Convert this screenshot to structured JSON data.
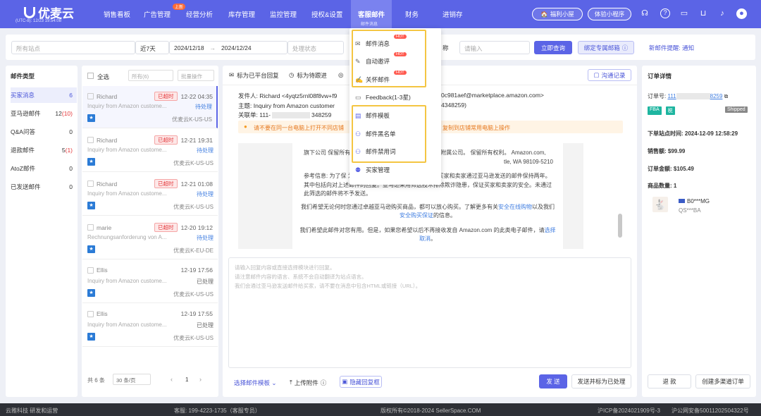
{
  "app": {
    "logo": "优麦云",
    "clock": "(UTC-8): 12/23 19:54:08"
  },
  "nav": {
    "items": [
      "销售看板",
      "广告管理",
      "经营分析",
      "库存管理",
      "监控管理",
      "授权&设置",
      "客服邮件",
      "财务",
      "进销存"
    ],
    "new_badge": "上新",
    "active": "客服邮件",
    "active_sub": "邮件消息"
  },
  "topbar": {
    "welfare": "福利小屋",
    "miniapp": "体验小程序",
    "icons": [
      "headset-icon",
      "help-icon",
      "document-icon",
      "cart-icon",
      "bell-icon",
      "user-icon"
    ]
  },
  "filter": {
    "site_placeholder": "所有站点",
    "range": "近7天",
    "date_start": "2024/12/18",
    "date_end": "2024/12/24",
    "status_placeholder": "处理状态",
    "field_tail": "称",
    "input_placeholder": "请输入",
    "query": "立即查询",
    "bind_mailbox": "绑定专属邮箱",
    "new_mail_reminder": "新邮件提醒: 通知"
  },
  "mail_types": {
    "title": "邮件类型",
    "items": [
      {
        "label": "买家消息",
        "count": "6",
        "red": ""
      },
      {
        "label": "亚马逊邮件",
        "count": "12",
        "red": "(10)"
      },
      {
        "label": "Q&A问答",
        "count": "0",
        "red": ""
      },
      {
        "label": "退款邮件",
        "count": "5",
        "red": "(1)"
      },
      {
        "label": "AtoZ邮件",
        "count": "0",
        "red": ""
      },
      {
        "label": "已发送邮件",
        "count": "0",
        "red": ""
      }
    ]
  },
  "list": {
    "select_all": "全选",
    "filter_all": "所有(6)",
    "batch": "批量操作",
    "total": "共 6 条",
    "page_size": "30 条/页",
    "page": "1",
    "messages": [
      {
        "name": "Richard",
        "overdue": "已超时",
        "time": "12-22 04:35",
        "subject": "Inquiry from Amazon custome...",
        "status": "待处理",
        "store": "优麦云K-US-US"
      },
      {
        "name": "Richard",
        "overdue": "已超时",
        "time": "12-21 19:31",
        "subject": "Inquiry from Amazon custome...",
        "status": "待处理",
        "store": "优麦云K-US-US"
      },
      {
        "name": "Richard",
        "overdue": "已超时",
        "time": "12-21 01:08",
        "subject": "Inquiry from Amazon custome...",
        "status": "待处理",
        "store": "优麦云K-US-US"
      },
      {
        "name": "marie",
        "overdue": "已超时",
        "time": "12-20 19:12",
        "subject": "Rechnungsanforderung von A...",
        "status": "待处理",
        "store": "优麦云K-EU-DE"
      },
      {
        "name": "Ellis",
        "overdue": "",
        "time": "12-19 17:56",
        "subject": "Inquiry from Amazon custome...",
        "status": "已处理",
        "store": "优麦云K-US-US"
      },
      {
        "name": "Ellis",
        "overdue": "",
        "time": "12-19 17:55",
        "subject": "Inquiry from Amazon custome...",
        "status": "已处理",
        "store": "优麦云K-US-US"
      }
    ]
  },
  "detail": {
    "mark_replied": "标为已平台回复",
    "mark_follow": "标为待跟进",
    "comm_log": "沟通记录",
    "sender_label": "发件人:",
    "sender": "Richard <4yqtz5rnl08f8vw+f9",
    "sender_tail": "0c981aef@marketplace.amazon.com>",
    "subject_label": "主题:",
    "subject": "Inquiry from Amazon customer",
    "subject_tail": "4348259)",
    "order_label": "关联单:",
    "order": "111-",
    "order_tail": "348259",
    "warning": "请不要在同一台电脑上打开不同店铺",
    "warning_tail": "复制到店铺常用电脑上操作",
    "body_p1": "旗下公司 保留所有",
    "body_p1b": "其附属公司。 保留所有权利。 Amazon.com,",
    "body_p1c": "tle, WA 98109-5210",
    "body_p2": "参考信息: 为了保",
    "body_p2b": "为帮助你截取在纠纷，我们会将所有买家和卖家通过亚马逊发送的邮件保持两年。其中包括向对上述邮件的回复。亚马逊采用筛选技术排除欺诈隐患，保证买家和卖家的安全。未通过此筛选的邮件将不予发送。",
    "body_p3": "我们希望无论何时您通过卓越亚马逊购买商品，都可以放心购买。了解更多有关",
    "body_p3_link": "安全在线购物",
    "body_p3b": "以及我们",
    "body_p3_link2": "安全购买保证",
    "body_p3c": "的信息。",
    "body_p4": "我们希望此邮件对您有用。但是，如果您希望以后不再接收发自 Amazon.com 的此类电子邮件，请",
    "body_p4_link": "选择取消",
    "body_p4b": "。",
    "reply_placeholder_1": "请输入回复内容或直接选择模块进行回复。",
    "reply_placeholder_2": "请注意邮件内容的语言、系统不会自动翻译为站点语言。",
    "reply_placeholder_3": "我们会通过亚马逊发送邮件给买家，请不要在消息中包含HTML或链接（URL）。",
    "choose_template": "选择邮件模板",
    "upload": "上传附件",
    "hide_reply": "隐藏回复框",
    "send": "发 送",
    "send_mark": "发送并标为已处理"
  },
  "dropdown": {
    "items": [
      {
        "label": "邮件消息",
        "hot": "HOT",
        "icon": "mail-icon"
      },
      {
        "label": "自动邀评",
        "hot": "HOT",
        "icon": "edit-icon"
      },
      {
        "label": "关怀邮件",
        "hot": "HOT",
        "icon": "care-icon"
      },
      {
        "label": "Feedback(1-3星)",
        "hot": "",
        "icon": "feedback-icon"
      },
      {
        "label": "邮件模板",
        "hot": "",
        "icon": "template-icon"
      },
      {
        "label": "邮件黑名单",
        "hot": "",
        "icon": "blacklist-icon"
      },
      {
        "label": "邮件禁用词",
        "hot": "",
        "icon": "banned-words-icon"
      },
      {
        "label": "买家管理",
        "hot": "",
        "icon": "buyer-icon"
      }
    ]
  },
  "order": {
    "title": "订单详情",
    "order_no_label": "订单号:",
    "order_no": "111",
    "order_no_tail": "8259",
    "tags": [
      "FBA",
      "税"
    ],
    "shipped": "Shipped",
    "order_time_label": "下单站点时间:",
    "order_time": "2024-12-09 12:58:29",
    "sales_label": "销售额:",
    "sales": "$99.99",
    "amount_label": "订单金额:",
    "amount": "$105.49",
    "qty_label": "商品数量:",
    "qty": "1",
    "sku": "B0***MG",
    "msku": "QS***BA",
    "refund": "退 款",
    "multi_order": "创建多渠道订单"
  },
  "footer": {
    "left": "云雅科技 研发和运营",
    "phone": "客服: 199-4223-1735（客服专员）",
    "copyright": "版权所有©2018-2024 SellerSpace.COM",
    "icp": "沪ICP备2024021909号-3",
    "police": "沪公网安备50011202504322号"
  },
  "colors": {
    "primary": "#5b64e6",
    "accent": "#4a55d8",
    "red": "#e5383b",
    "highlight": "#f4c542"
  }
}
